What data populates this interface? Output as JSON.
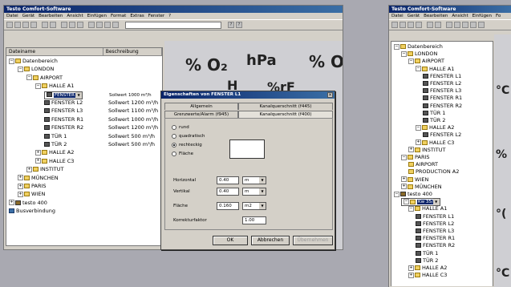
{
  "left_window": {
    "title": "Testo Comfort-Software",
    "menu": [
      "Datei",
      "Gerät",
      "Bearbeiten",
      "Ansicht",
      "Einfügen",
      "Format",
      "Extras",
      "Fenster",
      "?"
    ],
    "tree_headers": [
      "Dateiname",
      "Beschreibung"
    ],
    "tree": [
      {
        "label": "Datenbereich",
        "icon": "folder-icon",
        "level": 0,
        "expander": "−"
      },
      {
        "label": "LONDON",
        "icon": "folder-icon",
        "level": 1,
        "expander": "−"
      },
      {
        "label": "AIRPORT",
        "icon": "folder-icon",
        "level": 2,
        "expander": "−"
      },
      {
        "label": "HALLE A1",
        "icon": "folder-icon",
        "level": 3,
        "expander": "−"
      },
      {
        "label": "FENSTER L1",
        "icon": "probe-icon",
        "level": 4,
        "desc": "Sollwert 1000 m³/h",
        "selected": true
      },
      {
        "label": "FENSTER L2",
        "icon": "probe-icon",
        "level": 4,
        "desc": "Sollwert 1200 m³/h"
      },
      {
        "label": "FENSTER L3",
        "icon": "probe-icon",
        "level": 4,
        "desc": "Sollwert 1100 m³/h"
      },
      {
        "label": "FENSTER R1",
        "icon": "probe-icon",
        "level": 4,
        "desc": "Sollwert 1000 m³/h"
      },
      {
        "label": "FENSTER R2",
        "icon": "probe-icon",
        "level": 4,
        "desc": "Sollwert 1200 m³/h"
      },
      {
        "label": "TÜR 1",
        "icon": "probe-icon",
        "level": 4,
        "desc": "Sollwert 500 m³/h"
      },
      {
        "label": "TÜR 2",
        "icon": "probe-icon",
        "level": 4,
        "desc": "Sollwert 500 m³/h"
      },
      {
        "label": "HALLE A2",
        "icon": "folder-icon",
        "level": 3,
        "expander": "+"
      },
      {
        "label": "HALLE C3",
        "icon": "folder-icon",
        "level": 3,
        "expander": "+"
      },
      {
        "label": "INSTITUT",
        "icon": "folder-icon",
        "level": 2,
        "expander": "+"
      },
      {
        "label": "MÜNCHEN",
        "icon": "folder-icon",
        "level": 1,
        "expander": "+"
      },
      {
        "label": "PARIS",
        "icon": "folder-icon",
        "level": 1,
        "expander": "+"
      },
      {
        "label": "WIEN",
        "icon": "folder-icon",
        "level": 1,
        "expander": "+"
      },
      {
        "label": "testo 400",
        "icon": "device-icon",
        "level": 0,
        "expander": "+"
      },
      {
        "label": "Busverbindung",
        "icon": "link-icon",
        "level": 0
      }
    ],
    "big_labels": [
      "% O₂",
      "hPa",
      "% O",
      "H",
      "%rF"
    ]
  },
  "dialog": {
    "title": "Eigenschaften von FENSTER L1",
    "tabs_row1": [
      "Allgemein",
      "Kanalquerschnitt (f445)"
    ],
    "tabs_row2": [
      "Grenzwerte/Alarm (f945)",
      "Kanalquerschnitt (f400)"
    ],
    "shape_options": [
      "rund",
      "quadratisch",
      "rechteckig",
      "Fläche"
    ],
    "selected_shape": "rechteckig",
    "fields": [
      {
        "label": "Horizontal",
        "value": "0.40",
        "unit": "m"
      },
      {
        "label": "Vertikal",
        "value": "0.40",
        "unit": "m"
      },
      {
        "label": "Fläche",
        "value": "0.160",
        "unit": "m2"
      }
    ],
    "factor_label": "Korrekturfaktor",
    "factor_value": "1.00",
    "buttons": {
      "ok": "OK",
      "cancel": "Abbrechen",
      "apply": "Übernehmen"
    }
  },
  "right_window": {
    "title": "Testo Comfort-Software",
    "menu": [
      "Datei",
      "Gerät",
      "Bearbeiten",
      "Ansicht",
      "Einfügen",
      "Fo"
    ],
    "tree": [
      {
        "label": "Datenbereich",
        "icon": "folder-icon",
        "level": 0,
        "expander": "−"
      },
      {
        "label": "LONDON",
        "icon": "folder-icon",
        "level": 1,
        "expander": "−"
      },
      {
        "label": "AIRPORT",
        "icon": "folder-icon",
        "level": 2,
        "expander": "−"
      },
      {
        "label": "HALLE A1",
        "icon": "folder-icon",
        "level": 3,
        "expander": "−"
      },
      {
        "label": "FENSTER L1",
        "icon": "probe-icon",
        "level": 4
      },
      {
        "label": "FENSTER L2",
        "icon": "probe-icon",
        "level": 4
      },
      {
        "label": "FENSTER L3",
        "icon": "probe-icon",
        "level": 4
      },
      {
        "label": "FENSTER R1",
        "icon": "probe-icon",
        "level": 4
      },
      {
        "label": "FENSTER R2",
        "icon": "probe-icon",
        "level": 4
      },
      {
        "label": "TÜR 1",
        "icon": "probe-icon",
        "level": 4
      },
      {
        "label": "TÜR 2",
        "icon": "probe-icon",
        "level": 4
      },
      {
        "label": "HALLE A2",
        "icon": "folder-icon",
        "level": 3,
        "expander": "−"
      },
      {
        "label": "FENSTER L2",
        "icon": "probe-icon",
        "level": 4
      },
      {
        "label": "HALLE C3",
        "icon": "folder-icon",
        "level": 3,
        "expander": "+"
      },
      {
        "label": "INSTITUT",
        "icon": "folder-icon",
        "level": 2,
        "expander": "+"
      },
      {
        "label": "PARIS",
        "icon": "folder-icon",
        "level": 1,
        "expander": "−"
      },
      {
        "label": "AIRPORT",
        "icon": "folder-icon",
        "level": 2
      },
      {
        "label": "PRODUCTION A2",
        "icon": "folder-icon",
        "level": 2
      },
      {
        "label": "WIEN",
        "icon": "folder-icon",
        "level": 1,
        "expander": "+"
      },
      {
        "label": "MÜNCHEN",
        "icon": "folder-icon",
        "level": 1,
        "expander": "+"
      },
      {
        "label": "testo 400",
        "icon": "device-icon",
        "level": 0,
        "expander": "−"
      },
      {
        "label": "Kw 35/02",
        "icon": "folder-icon",
        "level": 1,
        "expander": "−",
        "selected": true
      },
      {
        "label": "HALLE A1",
        "icon": "folder-icon",
        "level": 2,
        "expander": "−"
      },
      {
        "label": "FENSTER L1",
        "icon": "probe-icon",
        "level": 3
      },
      {
        "label": "FENSTER L2",
        "icon": "probe-icon",
        "level": 3
      },
      {
        "label": "FENSTER L3",
        "icon": "probe-icon",
        "level": 3
      },
      {
        "label": "FENSTER R1",
        "icon": "probe-icon",
        "level": 3
      },
      {
        "label": "FENSTER R2",
        "icon": "probe-icon",
        "level": 3
      },
      {
        "label": "TÜR 1",
        "icon": "probe-icon",
        "level": 3
      },
      {
        "label": "TÜR 2",
        "icon": "probe-icon",
        "level": 3
      },
      {
        "label": "HALLE A2",
        "icon": "folder-icon",
        "level": 2,
        "expander": "+"
      },
      {
        "label": "HALLE C3",
        "icon": "folder-icon",
        "level": 2,
        "expander": "+"
      }
    ],
    "big_labels": [
      "°C",
      "%",
      "°(",
      "°C"
    ]
  }
}
